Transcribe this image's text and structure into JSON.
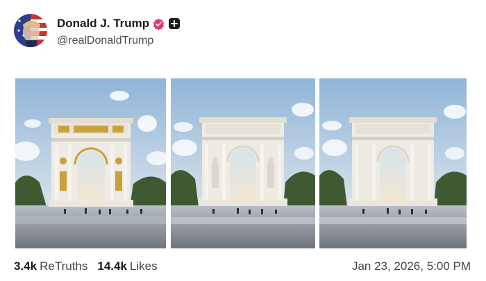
{
  "author": {
    "display_name": "Donald J. Trump",
    "handle": "@realDonaldTrump",
    "verified_icon": "verified-badge-icon",
    "plus_icon": "plus-badge-icon"
  },
  "media": [
    {
      "name": "arch-image-gold"
    },
    {
      "name": "arch-image-statues"
    },
    {
      "name": "arch-image-plain"
    }
  ],
  "stats": {
    "retruths_count": "3.4k",
    "retruths_label": "ReTruths",
    "likes_count": "14.4k",
    "likes_label": "Likes"
  },
  "timestamp": "Jan 23, 2026, 5:00 PM",
  "colors": {
    "verified": "#e8336d",
    "accent_dark": "#1a1a1a"
  }
}
